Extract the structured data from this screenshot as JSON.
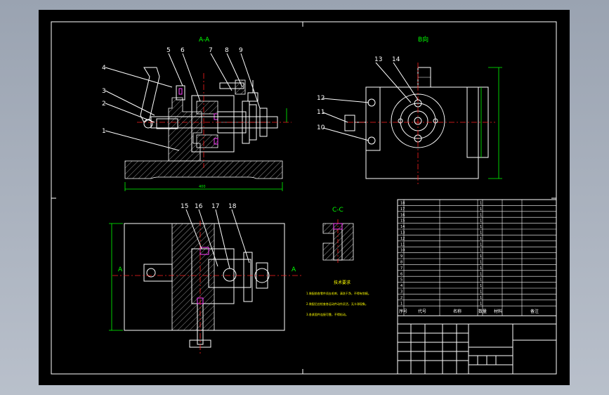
{
  "colors": {
    "background": "#000000",
    "frame": "#ffffff",
    "dimension": "#00ff00",
    "centerline": "#ff2020",
    "notes": "#ffff00",
    "highlight": "#ff40ff"
  },
  "views": {
    "front_section_title": "A-A",
    "side_view_title": "B向",
    "detail_title": "C-C",
    "top_view_marks": [
      "A",
      "A"
    ]
  },
  "part_balloons": {
    "front": [
      "4",
      "3",
      "2",
      "1",
      "5",
      "6",
      "7",
      "8",
      "9"
    ],
    "side": [
      "13",
      "14",
      "12",
      "11",
      "10"
    ],
    "top": [
      "15",
      "16",
      "17",
      "18"
    ]
  },
  "notes": {
    "title": "技术要求",
    "lines": [
      "1.装配前各零件须去毛刺、清洗干净，不得有划痕。",
      "2.装配后应检查各运动件动作灵活，无卡滞现象。",
      "3.各紧固件连接可靠，不得松动。"
    ]
  },
  "bom": {
    "rows": [
      [
        "18",
        "",
        "",
        "1",
        "",
        ""
      ],
      [
        "17",
        "",
        "",
        "1",
        "",
        ""
      ],
      [
        "16",
        "",
        "",
        "1",
        "",
        ""
      ],
      [
        "15",
        "",
        "",
        "1",
        "",
        ""
      ],
      [
        "14",
        "",
        "",
        "1",
        "",
        ""
      ],
      [
        "13",
        "",
        "",
        "1",
        "",
        ""
      ],
      [
        "12",
        "",
        "",
        "1",
        "",
        ""
      ],
      [
        "11",
        "",
        "",
        "1",
        "",
        ""
      ],
      [
        "10",
        "",
        "",
        "1",
        "",
        ""
      ],
      [
        "9",
        "",
        "",
        "1",
        "",
        ""
      ],
      [
        "8",
        "",
        "",
        "1",
        "",
        ""
      ],
      [
        "7",
        "",
        "",
        "1",
        "",
        ""
      ],
      [
        "6",
        "",
        "",
        "1",
        "",
        ""
      ],
      [
        "5",
        "",
        "",
        "1",
        "",
        ""
      ],
      [
        "4",
        "",
        "",
        "1",
        "",
        ""
      ],
      [
        "3",
        "",
        "",
        "1",
        "",
        ""
      ],
      [
        "2",
        "",
        "",
        "1",
        "",
        ""
      ],
      [
        "1",
        "",
        "",
        "1",
        "",
        ""
      ]
    ],
    "header": [
      "序号",
      "代号",
      "名称",
      "数量",
      "材料",
      "备注"
    ]
  }
}
